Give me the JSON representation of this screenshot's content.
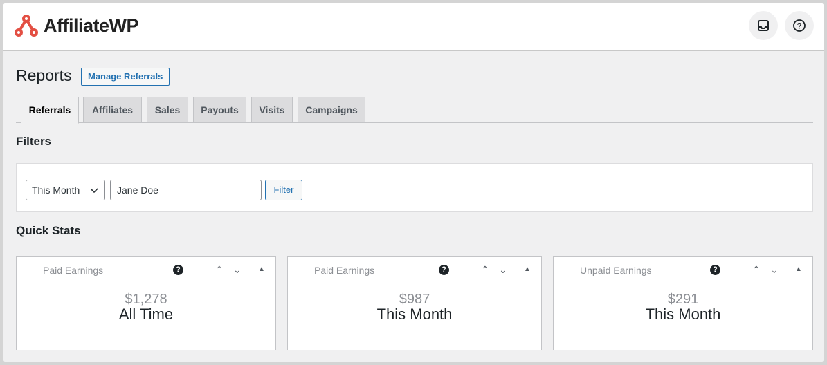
{
  "header": {
    "brand": "AffiliateWP",
    "brand_color": "#e34f43",
    "icons": [
      "inbox-icon",
      "help-icon"
    ]
  },
  "page": {
    "title": "Reports",
    "manage_label": "Manage Referrals"
  },
  "tabs": [
    {
      "label": "Referrals",
      "active": true
    },
    {
      "label": "Affiliates"
    },
    {
      "label": "Sales"
    },
    {
      "label": "Payouts"
    },
    {
      "label": "Visits"
    },
    {
      "label": "Campaigns"
    }
  ],
  "filters": {
    "heading": "Filters",
    "range": "This Month",
    "affiliate": "Jane Doe",
    "button": "Filter"
  },
  "quick_stats": {
    "heading": "Quick Stats",
    "cards": [
      {
        "title": "Paid Earnings",
        "amount": "$1,278",
        "period": "All Time"
      },
      {
        "title": "Paid Earnings",
        "amount": "$987",
        "period": "This Month"
      },
      {
        "title": "Unpaid Earnings",
        "amount": "$291",
        "period": "This Month"
      }
    ]
  }
}
